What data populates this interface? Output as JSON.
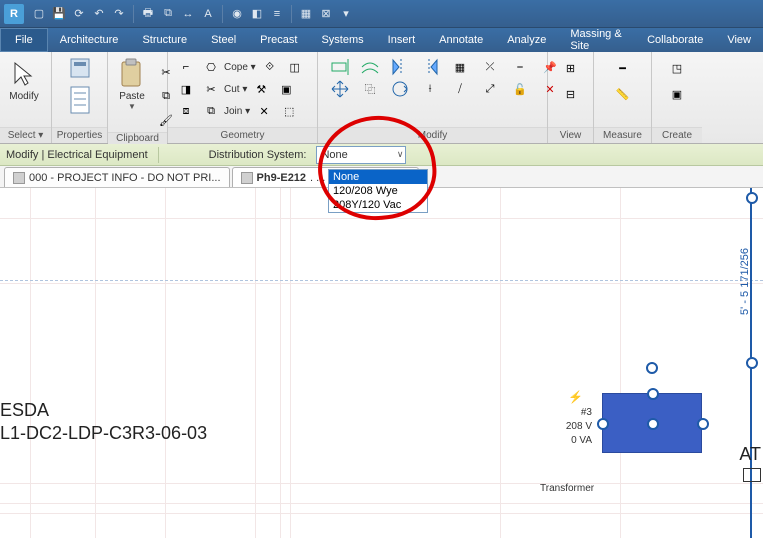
{
  "menubar": {
    "file": "File",
    "items": [
      "Architecture",
      "Structure",
      "Steel",
      "Precast",
      "Systems",
      "Insert",
      "Annotate",
      "Analyze",
      "Massing & Site",
      "Collaborate",
      "View"
    ]
  },
  "ribbon": {
    "panels": {
      "select": {
        "label": "Select ▾",
        "btn": "Modify"
      },
      "properties": {
        "label": "Properties"
      },
      "clipboard": {
        "label": "Clipboard",
        "paste": "Paste"
      },
      "geometry": {
        "label": "Geometry",
        "cope": "Cope ▾",
        "cut": "Cut ▾",
        "join": "Join ▾"
      },
      "modify": {
        "label": "Modify"
      },
      "view": {
        "label": "View"
      },
      "measure": {
        "label": "Measure"
      },
      "create": {
        "label": "Create"
      }
    }
  },
  "optbar": {
    "context": "Modify | Electrical Equipment",
    "distlabel": "Distribution System:",
    "value": "None",
    "options": [
      "None",
      "120/208 Wye",
      "208Y/120 Vac"
    ]
  },
  "tabs": [
    {
      "label": "000 - PROJECT INFO - DO NOT PRI...",
      "active": false
    },
    {
      "label": "Ph9-E212",
      "suffix": " . . . . . . . . R PL...",
      "active": true
    }
  ],
  "canvas": {
    "text1": "ESDA",
    "text2": "L1-DC2-LDP-C3R3-06-03",
    "text3": "AT",
    "dim": "5' - 5 171/256",
    "equip": {
      "tag": "#3",
      "volt": "208 V",
      "va": "0 VA",
      "type": "Transformer"
    }
  }
}
